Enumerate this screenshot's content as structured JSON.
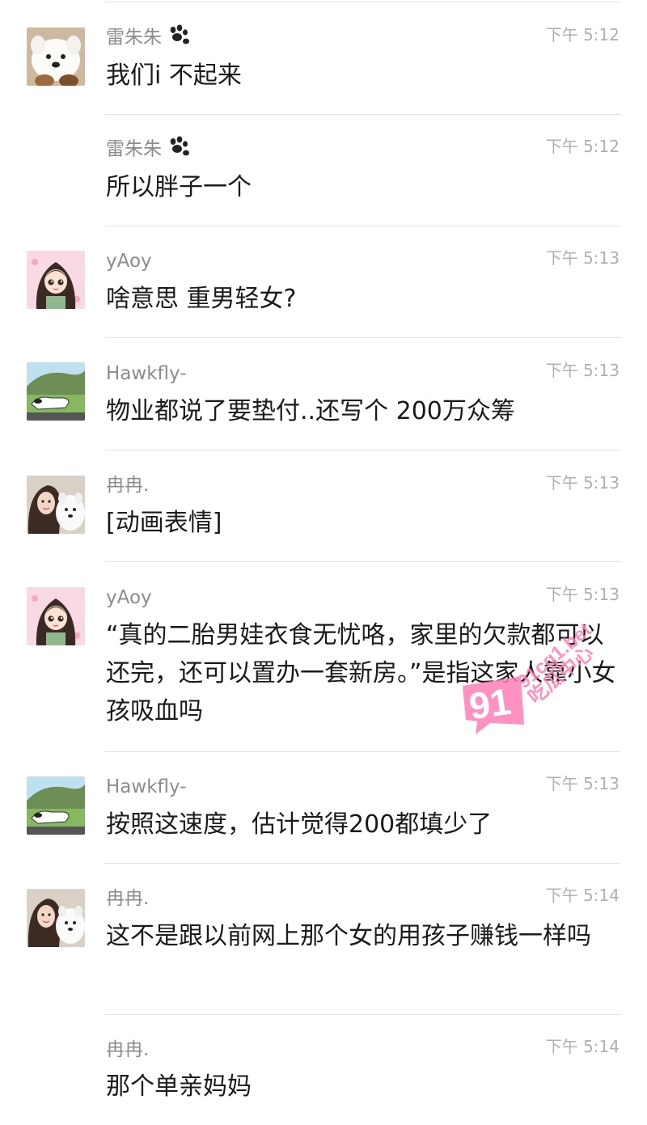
{
  "messages": [
    {
      "sender": "雷朱朱",
      "paw": true,
      "time": "下午 5:12",
      "text": "我们i 不起来",
      "avatar": "dog-avatar"
    },
    {
      "sender": "雷朱朱",
      "paw": true,
      "time": "下午 5:12",
      "text": "所以胖子一个",
      "avatar": null
    },
    {
      "sender": "yAoy",
      "paw": false,
      "time": "下午 5:13",
      "text": "啥意思 重男轻女?",
      "avatar": "cartoon-girl-avatar"
    },
    {
      "sender": "Hawkfly-",
      "paw": false,
      "time": "下午 5:13",
      "text": "物业都说了要垫付..还写个 200万众筹",
      "avatar": "snoopy-avatar"
    },
    {
      "sender": "冉冉.",
      "paw": false,
      "time": "下午 5:13",
      "text": "[动画表情]",
      "avatar": "girl-with-dog-avatar"
    },
    {
      "sender": "yAoy",
      "paw": false,
      "time": "下午 5:13",
      "text": "“真的二胎男娃衣食无忧咯，家里的欠款都可以还完，还可以置办一套新房。”是指这家人靠小女孩吸血吗",
      "avatar": "cartoon-girl-avatar"
    },
    {
      "sender": "Hawkfly-",
      "paw": false,
      "time": "下午 5:13",
      "text": "按照这速度，估计觉得200都填少了",
      "avatar": "snoopy-avatar"
    },
    {
      "sender": "冉冉.",
      "paw": false,
      "time": "下午 5:14",
      "text": "这不是跟以前网上那个女的用孩子赚钱一样吗",
      "avatar": "girl-with-dog-avatar"
    },
    {
      "sender": "冉冉.",
      "paw": false,
      "time": "下午 5:14",
      "text": "那个单亲妈妈",
      "avatar": null
    }
  ],
  "watermark": {
    "logo": "91",
    "line1": "91cg1.bet",
    "line2": "吃瓜中心"
  },
  "colors": {
    "name": "#8c8c8c",
    "time": "#b0b0b0",
    "text": "#1a1a1a",
    "divider": "#e3e3e3",
    "watermark": "#ff7fb6"
  }
}
